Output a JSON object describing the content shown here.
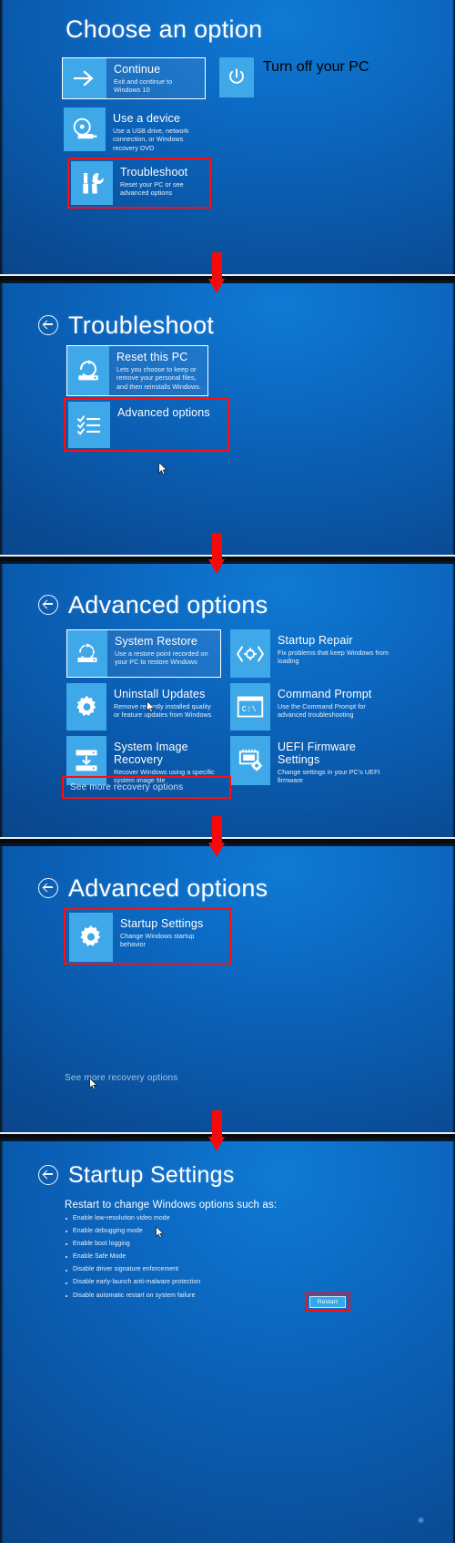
{
  "meta": {
    "description": "Windows Recovery Environment navigation steps, five stacked boot-menu screenshots with red callouts and red arrows",
    "accent_red": "#ff0d0d",
    "tile_blue": "#3fa8e8",
    "screen_blue": "#0c69c2"
  },
  "panels": [
    {
      "id": "choose-an-option",
      "title": "Choose an option",
      "has_back": false,
      "tiles": [
        {
          "name": "continue",
          "title": "Continue",
          "desc": "Exit and continue to Windows 10",
          "icon": "arrow-right-icon",
          "focused": true,
          "highlighted": false
        },
        {
          "name": "use-a-device",
          "title": "Use a device",
          "desc": "Use a USB drive, network connection, or Windows recovery DVD",
          "icon": "disc-usb-icon",
          "focused": false,
          "highlighted": false
        },
        {
          "name": "troubleshoot",
          "title": "Troubleshoot",
          "desc": "Reset your PC or see advanced options",
          "icon": "tools-icon",
          "focused": false,
          "highlighted": true
        },
        {
          "name": "turn-off-your-pc",
          "title": "Turn off your PC",
          "desc": "",
          "icon": "power-icon",
          "focused": false,
          "highlighted": false
        }
      ]
    },
    {
      "id": "troubleshoot",
      "title": "Troubleshoot",
      "has_back": true,
      "tiles": [
        {
          "name": "reset-this-pc",
          "title": "Reset this PC",
          "desc": "Lets you choose to keep or remove your personal files, and then reinstalls Windows.",
          "icon": "reset-pc-icon",
          "focused": true,
          "highlighted": false
        },
        {
          "name": "advanced-options",
          "title": "Advanced options",
          "desc": "",
          "icon": "checklist-icon",
          "focused": false,
          "highlighted": true
        }
      ]
    },
    {
      "id": "advanced-options",
      "title": "Advanced options",
      "has_back": true,
      "tiles": [
        {
          "name": "system-restore",
          "title": "System Restore",
          "desc": "Use a restore point recorded on your PC to restore Windows",
          "icon": "system-restore-icon",
          "focused": true,
          "highlighted": false
        },
        {
          "name": "startup-repair",
          "title": "Startup Repair",
          "desc": "Fix problems that keep Windows from loading",
          "icon": "startup-repair-icon",
          "focused": false,
          "highlighted": false
        },
        {
          "name": "uninstall-updates",
          "title": "Uninstall Updates",
          "desc": "Remove recently installed quality or feature updates from Windows",
          "icon": "gear-icon",
          "focused": false,
          "highlighted": false
        },
        {
          "name": "command-prompt",
          "title": "Command Prompt",
          "desc": "Use the Command Prompt for advanced troubleshooting",
          "icon": "command-prompt-icon",
          "focused": false,
          "highlighted": false
        },
        {
          "name": "system-image-recovery",
          "title": "System Image Recovery",
          "desc": "Recover Windows using a specific system image file",
          "icon": "system-image-icon",
          "focused": false,
          "highlighted": false
        },
        {
          "name": "uefi-firmware-settings",
          "title": "UEFI Firmware Settings",
          "desc": "Change settings in your PC's UEFI firmware",
          "icon": "uefi-chip-icon",
          "focused": false,
          "highlighted": false
        }
      ],
      "see_more_link": "See more recovery options"
    },
    {
      "id": "advanced-options-more",
      "title": "Advanced options",
      "has_back": true,
      "tiles": [
        {
          "name": "startup-settings",
          "title": "Startup Settings",
          "desc": "Change Windows startup behavior",
          "icon": "gear-icon",
          "focused": false,
          "highlighted": true
        }
      ],
      "see_more_link": "See more recovery options"
    },
    {
      "id": "startup-settings",
      "title": "Startup Settings",
      "has_back": true,
      "lead": "Restart to change Windows options such as:",
      "options": [
        "Enable low-resolution video mode",
        "Enable debugging mode",
        "Enable boot logging",
        "Enable Safe Mode",
        "Disable driver signature enforcement",
        "Disable early-launch anti-malware protection",
        "Disable automatic restart on system failure"
      ],
      "restart_button": "Restart"
    }
  ]
}
